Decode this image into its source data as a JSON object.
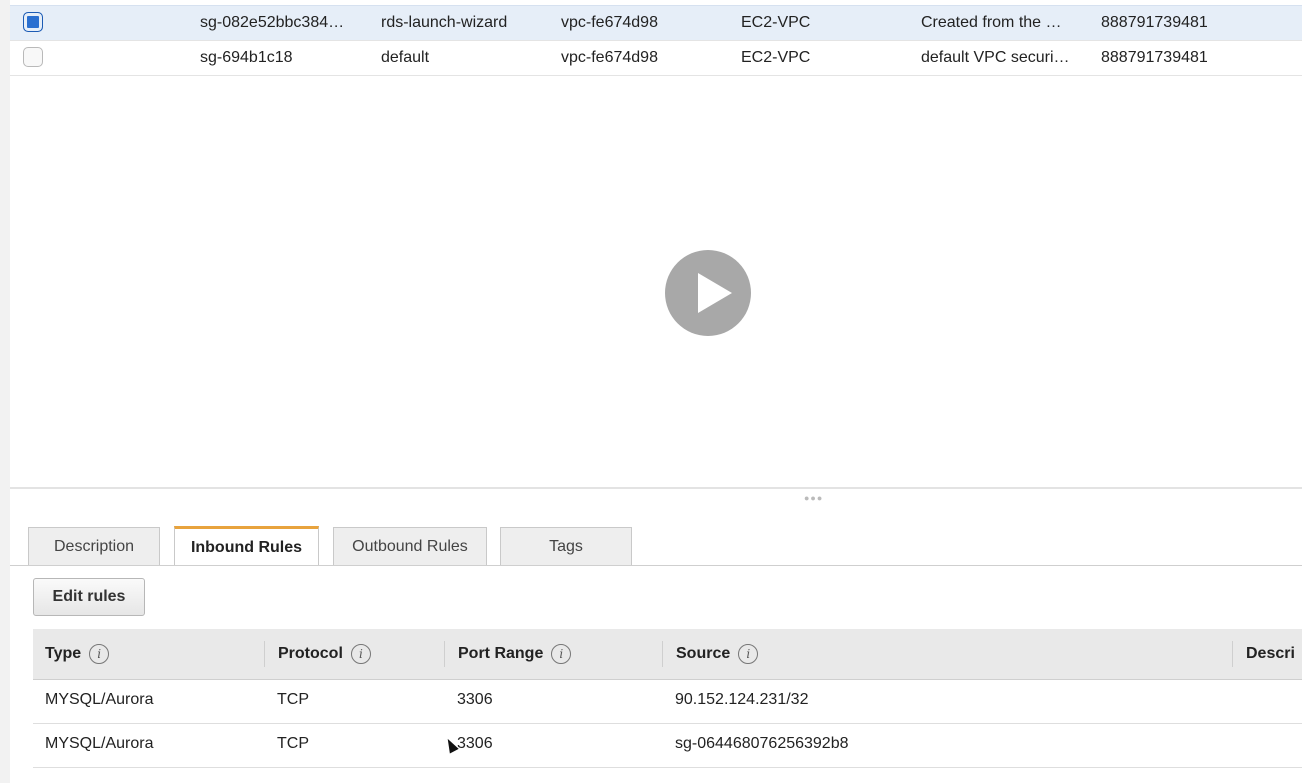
{
  "security_groups": {
    "rows": [
      {
        "selected": true,
        "group_id": "sg-082e52bbc384…",
        "group_name": "rds-launch-wizard",
        "vpc_id": "vpc-fe674d98",
        "type": "EC2-VPC",
        "description": "Created from the …",
        "owner": "888791739481"
      },
      {
        "selected": false,
        "group_id": "sg-694b1c18",
        "group_name": "default",
        "vpc_id": "vpc-fe674d98",
        "type": "EC2-VPC",
        "description": "default VPC securi…",
        "owner": "888791739481"
      }
    ]
  },
  "overlay": {
    "icon": "play-icon"
  },
  "details": {
    "tabs": [
      {
        "label": "Description",
        "active": false
      },
      {
        "label": "Inbound Rules",
        "active": true
      },
      {
        "label": "Outbound Rules",
        "active": false
      },
      {
        "label": "Tags",
        "active": false
      }
    ],
    "edit_rules_label": "Edit rules",
    "columns": [
      "Type",
      "Protocol",
      "Port Range",
      "Source",
      "Descri"
    ],
    "info_glyph": "i",
    "rules": [
      {
        "type": "MYSQL/Aurora",
        "protocol": "TCP",
        "port_range": "3306",
        "source": "90.152.124.231/32"
      },
      {
        "type": "MYSQL/Aurora",
        "protocol": "TCP",
        "port_range": "3306",
        "source": "sg-064468076256392b8"
      }
    ]
  },
  "colors": {
    "selected_row": "#e6eef8",
    "checkbox_checked": "#2a6fd0",
    "active_tab_accent": "#e8a33d",
    "header_bg": "#e9e9e9"
  }
}
